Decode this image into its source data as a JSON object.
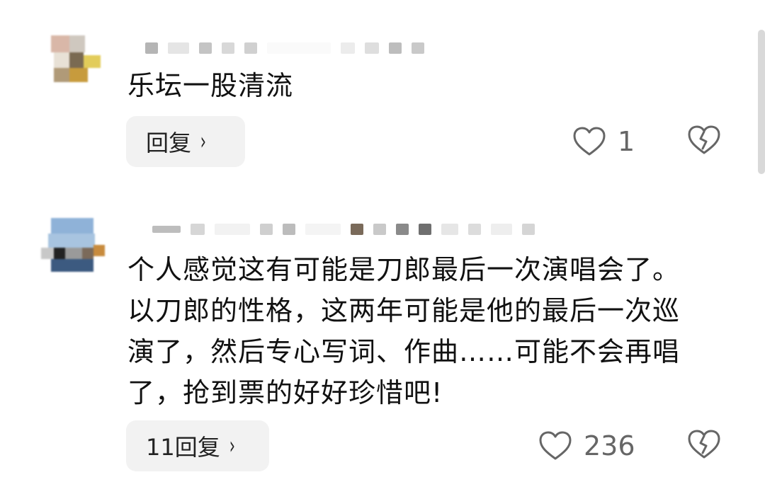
{
  "comments": [
    {
      "username": "",
      "text": "乐坛一股清流",
      "reply_label": "回复",
      "reply_chevron": "›",
      "likes": "1",
      "like_icon": "heart-outline-icon",
      "dislike_icon": "broken-heart-icon"
    },
    {
      "username": "",
      "text": "个人感觉这有可能是刀郎最后一次演唱会了。\n以刀郎的性格，这两年可能是他的最后一次巡\n演了，然后专心写词、作曲……可能不会再唱\n了，抢到票的好好珍惜吧!",
      "reply_label": "11回复",
      "reply_chevron": "›",
      "likes": "236",
      "like_icon": "heart-outline-icon",
      "dislike_icon": "broken-heart-icon"
    }
  ]
}
